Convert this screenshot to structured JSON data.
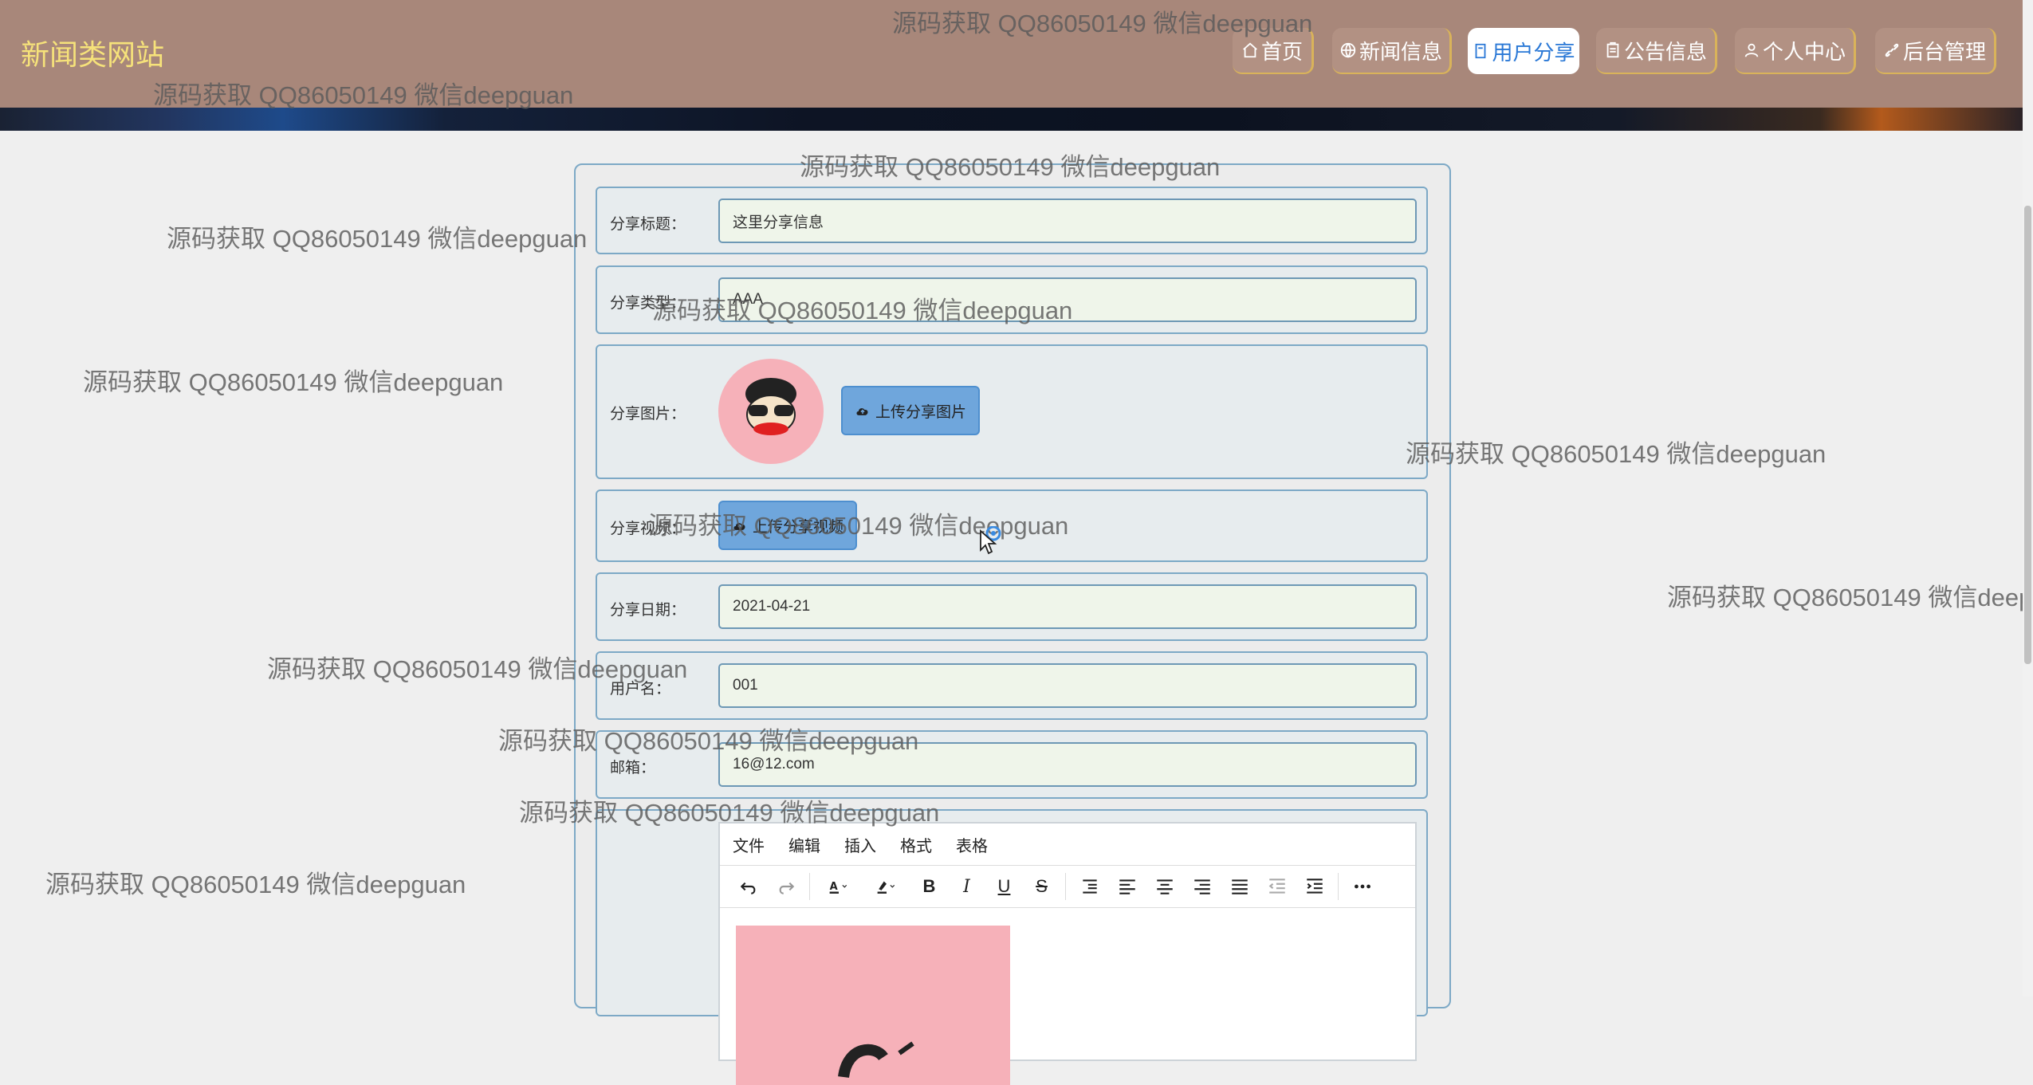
{
  "site": {
    "title": "新闻类网站"
  },
  "nav": [
    {
      "label": "首页",
      "icon": "home-icon"
    },
    {
      "label": "新闻信息",
      "icon": "globe-icon"
    },
    {
      "label": "用户分享",
      "icon": "share-doc-icon",
      "active": true
    },
    {
      "label": "公告信息",
      "icon": "clipboard-icon"
    },
    {
      "label": "个人中心",
      "icon": "user-icon"
    },
    {
      "label": "后台管理",
      "icon": "link-icon"
    }
  ],
  "form": {
    "title_label": "分享标题：",
    "title_value": "这里分享信息",
    "type_label": "分享类型：",
    "type_value": "AAA",
    "image_label": "分享图片：",
    "image_button": "上传分享图片",
    "video_label": "分享视频：",
    "video_button": "上传分享视频",
    "date_label": "分享日期：",
    "date_value": "2021-04-21",
    "username_label": "用户名：",
    "username_value": "001",
    "email_label": "邮箱：",
    "email_value": "16@12.com"
  },
  "editor": {
    "menus": [
      "文件",
      "编辑",
      "插入",
      "格式",
      "表格"
    ],
    "tools": [
      "undo-icon",
      "redo-icon",
      "text-color-icon",
      "highlight-icon",
      "bold-icon",
      "italic-icon",
      "underline-icon",
      "strikethrough-icon",
      "line-height-icon",
      "align-left-icon",
      "align-center-icon",
      "align-right-icon",
      "justify-icon",
      "outdent-icon",
      "indent-icon",
      "more-icon"
    ]
  },
  "watermark": {
    "text": "源码获取 QQ86050149 微信deepguan"
  },
  "colors": {
    "header": "#a8877a",
    "logo": "#f6e27a",
    "accent": "#2a78d6",
    "nav_border": "#d9b35a",
    "upload_button": "#6fa6dc",
    "input_bg": "#eff5ea"
  }
}
